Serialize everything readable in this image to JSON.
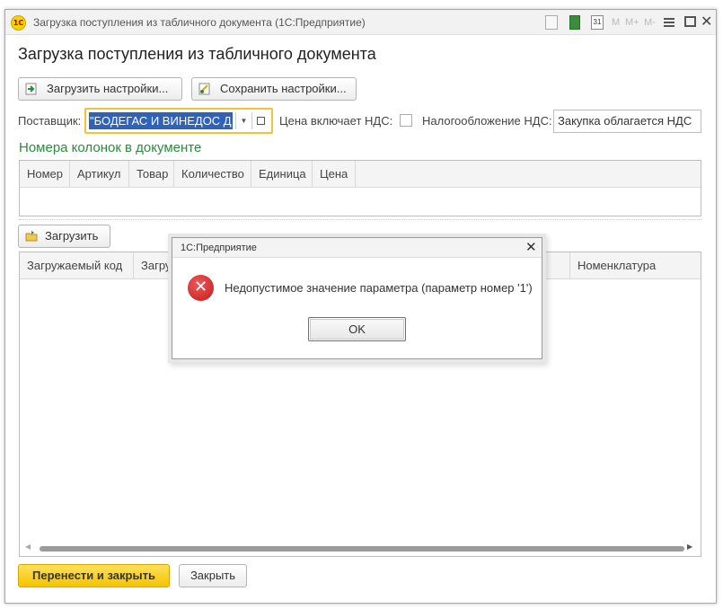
{
  "window": {
    "logo_text": "1С",
    "title": "Загрузка поступления из табличного документа  (1С:Предприятие)",
    "toolbar_icons": [
      "document-icon",
      "calculator-icon",
      "calendar-icon",
      "m-icon",
      "mplus-icon",
      "mminus-icon",
      "menu-icon",
      "maximize-icon",
      "close-icon"
    ],
    "cal_day": "31",
    "m_labels": [
      "M",
      "M+",
      "M-"
    ],
    "close_glyph": "✕"
  },
  "form": {
    "title": "Загрузка поступления из табличного документа",
    "load_settings_label": "Загрузить настройки...",
    "save_settings_label": "Сохранить настройки...",
    "supplier_label": "Поставщик:",
    "supplier_value": "\"БОДЕГАС И ВИНЕДОС Д",
    "dropdown_glyph": "▼",
    "price_vat_label": "Цена включает НДС:",
    "price_vat_checked": false,
    "taxation_label": "Налогообложение НДС:",
    "taxation_value": "Закупка облагается НДС",
    "columns_section_title": "Номера колонок в документе",
    "columns_table_headers": [
      "Номер",
      "Артикул",
      "Товар",
      "Количество",
      "Единица",
      "Цена"
    ],
    "load_button_label": "Загрузить",
    "data_table_headers": {
      "code": "Загружаемый код",
      "second": "Загруж",
      "nomenclature": "Номенклатура"
    },
    "scroll_left_glyph": "◀",
    "scroll_right_glyph": "▶",
    "transfer_close_label": "Перенести и закрыть",
    "close_label": "Закрыть"
  },
  "dialog": {
    "title": "1С:Предприятие",
    "close_glyph": "✕",
    "error_glyph": "✕",
    "message": "Недопустимое значение параметра (параметр номер '1')",
    "ok_label": "OK"
  },
  "colors": {
    "accent_yellow": "#f5c400",
    "section_green": "#2b8a3e",
    "selection_blue": "#3062b8",
    "error_red": "#c41818"
  }
}
